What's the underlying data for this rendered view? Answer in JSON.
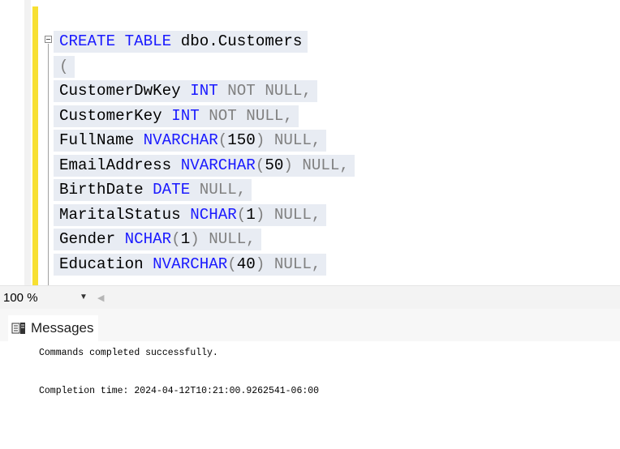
{
  "editor": {
    "lines": [
      [
        {
          "t": "CREATE TABLE",
          "c": "kw"
        },
        {
          "t": " dbo.Customers",
          "c": ""
        }
      ],
      [
        {
          "t": "(",
          "c": "gr"
        }
      ],
      [
        {
          "t": "CustomerDwKey ",
          "c": ""
        },
        {
          "t": "INT",
          "c": "kw"
        },
        {
          "t": " NOT NULL,",
          "c": "gr"
        }
      ],
      [
        {
          "t": "CustomerKey ",
          "c": ""
        },
        {
          "t": "INT",
          "c": "kw"
        },
        {
          "t": " NOT NULL,",
          "c": "gr"
        }
      ],
      [
        {
          "t": "FullName ",
          "c": ""
        },
        {
          "t": "NVARCHAR",
          "c": "kw"
        },
        {
          "t": "(",
          "c": "gr"
        },
        {
          "t": "150",
          "c": ""
        },
        {
          "t": ") NULL,",
          "c": "gr"
        }
      ],
      [
        {
          "t": "EmailAddress ",
          "c": ""
        },
        {
          "t": "NVARCHAR",
          "c": "kw"
        },
        {
          "t": "(",
          "c": "gr"
        },
        {
          "t": "50",
          "c": ""
        },
        {
          "t": ") NULL,",
          "c": "gr"
        }
      ],
      [
        {
          "t": "BirthDate ",
          "c": ""
        },
        {
          "t": "DATE",
          "c": "kw"
        },
        {
          "t": " NULL,",
          "c": "gr"
        }
      ],
      [
        {
          "t": "MaritalStatus ",
          "c": ""
        },
        {
          "t": "NCHAR",
          "c": "kw"
        },
        {
          "t": "(",
          "c": "gr"
        },
        {
          "t": "1",
          "c": ""
        },
        {
          "t": ") NULL,",
          "c": "gr"
        }
      ],
      [
        {
          "t": "Gender ",
          "c": ""
        },
        {
          "t": "NCHAR",
          "c": "kw"
        },
        {
          "t": "(",
          "c": "gr"
        },
        {
          "t": "1",
          "c": ""
        },
        {
          "t": ") NULL,",
          "c": "gr"
        }
      ],
      [
        {
          "t": "Education ",
          "c": ""
        },
        {
          "t": "NVARCHAR",
          "c": "kw"
        },
        {
          "t": "(",
          "c": "gr"
        },
        {
          "t": "40",
          "c": ""
        },
        {
          "t": ") NULL,",
          "c": "gr"
        }
      ]
    ]
  },
  "zoom": {
    "value": "100 %"
  },
  "messages": {
    "tab_label": "Messages",
    "tab_icon": "messages-icon",
    "lines": [
      "Commands completed successfully.",
      "Completion time: 2024-04-12T10:21:00.9262541-06:00"
    ]
  },
  "colors": {
    "keyword": "#1a1aff",
    "gray": "#808080",
    "selection": "#e8ecf3",
    "change_bar": "#f7e032"
  }
}
